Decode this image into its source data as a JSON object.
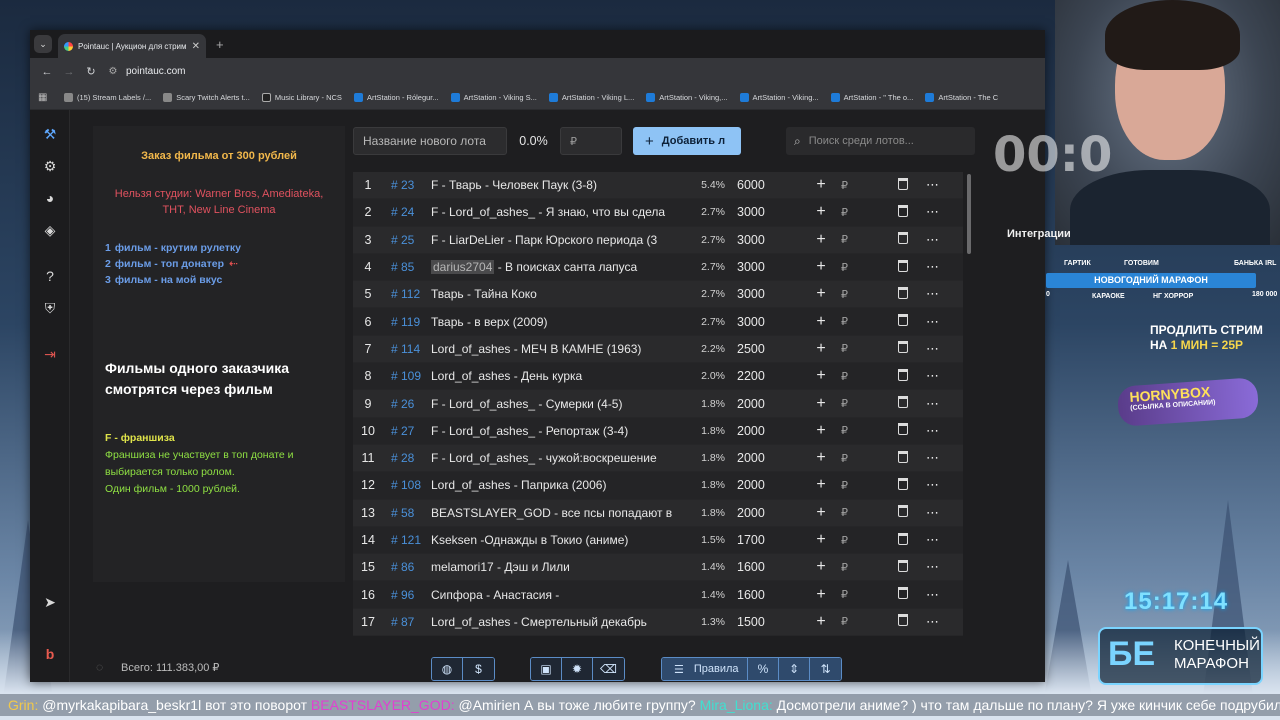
{
  "browser": {
    "tab_title": "Pointauc | Аукцион для стрим",
    "url": "pointauc.com",
    "bookmarks": [
      {
        "label": "(15) Stream Labels /...",
        "icon": "sa"
      },
      {
        "label": "Scary Twitch Alerts t...",
        "icon": "sa"
      },
      {
        "label": "Music Library - NCS",
        "icon": "nc"
      },
      {
        "label": "ArtStation - Rólegur...",
        "icon": "as"
      },
      {
        "label": "ArtStation - Viking S...",
        "icon": "as"
      },
      {
        "label": "ArtStation - Viking L...",
        "icon": "as"
      },
      {
        "label": "ArtStation - Viking,...",
        "icon": "as"
      },
      {
        "label": "ArtStation - Viking...",
        "icon": "as"
      },
      {
        "label": "ArtStation - \" The o...",
        "icon": "as"
      },
      {
        "label": "ArtStation - The C",
        "icon": "as"
      }
    ]
  },
  "rules": {
    "title": "Заказ фильма от 300 рублей",
    "forbidden_line1": "Нельзя студии: Warner Bros, Amediateka,",
    "forbidden_line2": "ТНТ, New Line Cinema",
    "items": [
      {
        "num": "1",
        "text": "фильм - крутим рулетку"
      },
      {
        "num": "2",
        "text": "фильм - топ донатер"
      },
      {
        "num": "3",
        "text": "фильм - на мой вкус"
      }
    ],
    "arrow": "⇠",
    "big_line1": "Фильмы одного заказчика",
    "big_line2": "смотрятся через фильм",
    "franchise_head": "F - франшиза",
    "franchise_line1": "Франшиза не участвует в топ донате и",
    "franchise_line2": "выбирается только ролом.",
    "franchise_line3": "Один фильм - 1000 рублей."
  },
  "controls": {
    "lot_placeholder": "Название нового лота",
    "percent": "0.0%",
    "rub_symbol": "₽",
    "add_label": "Добавить л",
    "search_placeholder": "Поиск среди лотов..."
  },
  "lots": [
    {
      "idx": "1",
      "id": "# 23",
      "name": "F - Тварь - Человек Паук (3-8)",
      "pct": "5.4%",
      "amount": "6000"
    },
    {
      "idx": "2",
      "id": "# 24",
      "name": "F - Lord_of_ashes_ - Я знаю, что вы сдела",
      "pct": "2.7%",
      "amount": "3000"
    },
    {
      "idx": "3",
      "id": "# 25",
      "name": "F - LiarDeLier - Парк Юрского периода (3",
      "pct": "2.7%",
      "amount": "3000"
    },
    {
      "idx": "4",
      "id": "# 85",
      "name_hl": "darius2704",
      "name": " - В поисках санта лапуса",
      "pct": "2.7%",
      "amount": "3000"
    },
    {
      "idx": "5",
      "id": "# 112",
      "name": "Тварь - Тайна Коко",
      "pct": "2.7%",
      "amount": "3000"
    },
    {
      "idx": "6",
      "id": "# 119",
      "name": "Тварь - в верх (2009)",
      "pct": "2.7%",
      "amount": "3000"
    },
    {
      "idx": "7",
      "id": "# 114",
      "name": "Lord_of_ashes - МЕЧ В КАМНЕ (1963)",
      "pct": "2.2%",
      "amount": "2500"
    },
    {
      "idx": "8",
      "id": "# 109",
      "name": " Lord_of_ashes - День курка",
      "pct": "2.0%",
      "amount": "2200"
    },
    {
      "idx": "9",
      "id": "# 26",
      "name": "F - Lord_of_ashes_ - Сумерки (4-5)",
      "pct": "1.8%",
      "amount": "2000"
    },
    {
      "idx": "10",
      "id": "# 27",
      "name": "F - Lord_of_ashes_ - Репортаж (3-4)",
      "pct": "1.8%",
      "amount": "2000"
    },
    {
      "idx": "11",
      "id": "# 28",
      "name": "F - Lord_of_ashes_ - чужой:воскрешение",
      "pct": "1.8%",
      "amount": "2000"
    },
    {
      "idx": "12",
      "id": "# 108",
      "name": " Lord_of_ashes - Паприка (2006)",
      "pct": "1.8%",
      "amount": "2000"
    },
    {
      "idx": "13",
      "id": "# 58",
      "name": "BEASTSLAYER_GOD - все псы попадают в",
      "pct": "1.8%",
      "amount": "2000"
    },
    {
      "idx": "14",
      "id": "# 121",
      "name": " Kseksen -Однажды в Токио (аниме)",
      "pct": "1.5%",
      "amount": "1700"
    },
    {
      "idx": "15",
      "id": "# 86",
      "name": "melamori17 - Дэш и Лили",
      "pct": "1.4%",
      "amount": "1600"
    },
    {
      "idx": "16",
      "id": "# 96",
      "name": "Сипфора - Анастасия -",
      "pct": "1.4%",
      "amount": "1600"
    },
    {
      "idx": "17",
      "id": "# 87",
      "name": "Lord_of_ashes - Смертельный декабрь",
      "pct": "1.3%",
      "amount": "1500"
    }
  ],
  "bottom": {
    "total": "Всего: 111.383,00 ₽",
    "rules_label": "Правила"
  },
  "overlay": {
    "timer": "00:0",
    "integration": "Интеграции",
    "marathon_title": "НОВОГОДНИЙ МАРАФОН",
    "marathon_top": [
      "ГАРТИК",
      "ГОТОВИМ",
      "БАНЬКА IRL"
    ],
    "marathon_bottom": [
      "КАРАОКЕ",
      "НГ ХОРРОР"
    ],
    "marathon_start": "0",
    "marathon_end": "180 000",
    "extend_line1": "ПРОДЛИТЬ СТРИМ",
    "extend_line2_prefix": "НА ",
    "extend_line2_value": "1 МИН = 25Р",
    "promo": "HORNYBOX",
    "promo_sub": "(ССЫЛКА В ОПИСАНИИ)",
    "clock": "15:17:14",
    "logo_big": "БЕ",
    "logo_line1": "КОНЕЧНЫЙ",
    "logo_line2": "МАРАФОН"
  },
  "ticker": {
    "n1": "Grin:",
    "m1": " @myrkakapibara_beskr1l вот это поворот ",
    "n2": "BEASTSLAYER_GOD:",
    "m2": " @Amirien А вы тоже любите группу? ",
    "n3": "Mira_Liona:",
    "m3": " Досмотрели аниме? ) что там дальше по плану? Я уже кинчик себе подрубила"
  }
}
